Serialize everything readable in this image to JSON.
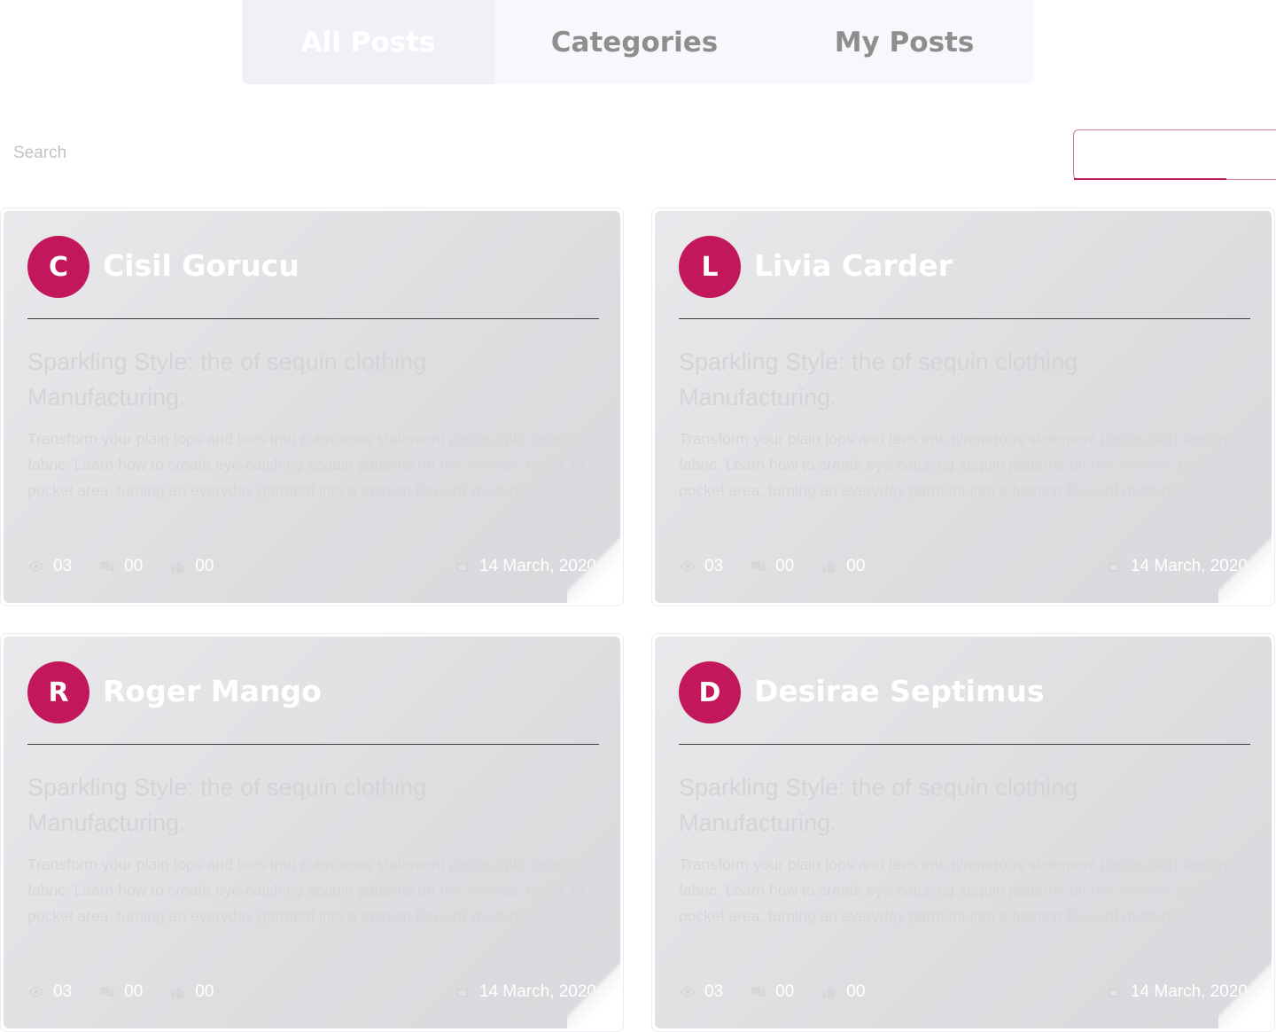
{
  "tabs": [
    {
      "label": "All Posts",
      "active": true
    },
    {
      "label": "Categories",
      "active": false
    },
    {
      "label": "My Posts",
      "active": false
    }
  ],
  "search": {
    "label": "Search",
    "value": ""
  },
  "colors": {
    "accent": "#c2185b",
    "tab_bg": "#f7f8fc"
  },
  "posts": [
    {
      "initial": "C",
      "author": "Cisil Gorucu",
      "title": "Sparkling Style: the of sequin clothing Manufacturing.",
      "body": "Transform your plain tops and tees into glamorous statement pieces with sequin fabric. Learn how to create eye-catching sequin patterns on the sleeves, collar, or pocket area, turning an everyday garment into a fashion forward must-have.",
      "views": "03",
      "comments": "00",
      "likes": "00",
      "date": "14 March, 2020"
    },
    {
      "initial": "L",
      "author": "Livia Carder",
      "title": "Sparkling Style: the of sequin clothing Manufacturing.",
      "body": "Transform your plain tops and tees into glamorous statement pieces with sequin fabric. Learn how to create eye-catching sequin patterns on the sleeves, collar, or pocket area, turning an everyday garment into a fashion forward must-have.",
      "views": "03",
      "comments": "00",
      "likes": "00",
      "date": "14 March, 2020"
    },
    {
      "initial": "R",
      "author": "Roger Mango",
      "title": "Sparkling Style: the of sequin clothing Manufacturing.",
      "body": "Transform your plain tops and tees into glamorous statement pieces with sequin fabric. Learn how to create eye-catching sequin patterns on the sleeves, collar, or pocket area, turning an everyday garment into a fashion forward must-have.",
      "views": "03",
      "comments": "00",
      "likes": "00",
      "date": "14 March, 2020"
    },
    {
      "initial": "D",
      "author": "Desirae Septimus",
      "title": "Sparkling Style: the of sequin clothing Manufacturing.",
      "body": "Transform your plain tops and tees into glamorous statement pieces with sequin fabric. Learn how to create eye-catching sequin patterns on the sleeves, collar, or pocket area, turning an everyday garment into a fashion forward must-have.",
      "views": "03",
      "comments": "00",
      "likes": "00",
      "date": "14 March, 2020"
    }
  ]
}
